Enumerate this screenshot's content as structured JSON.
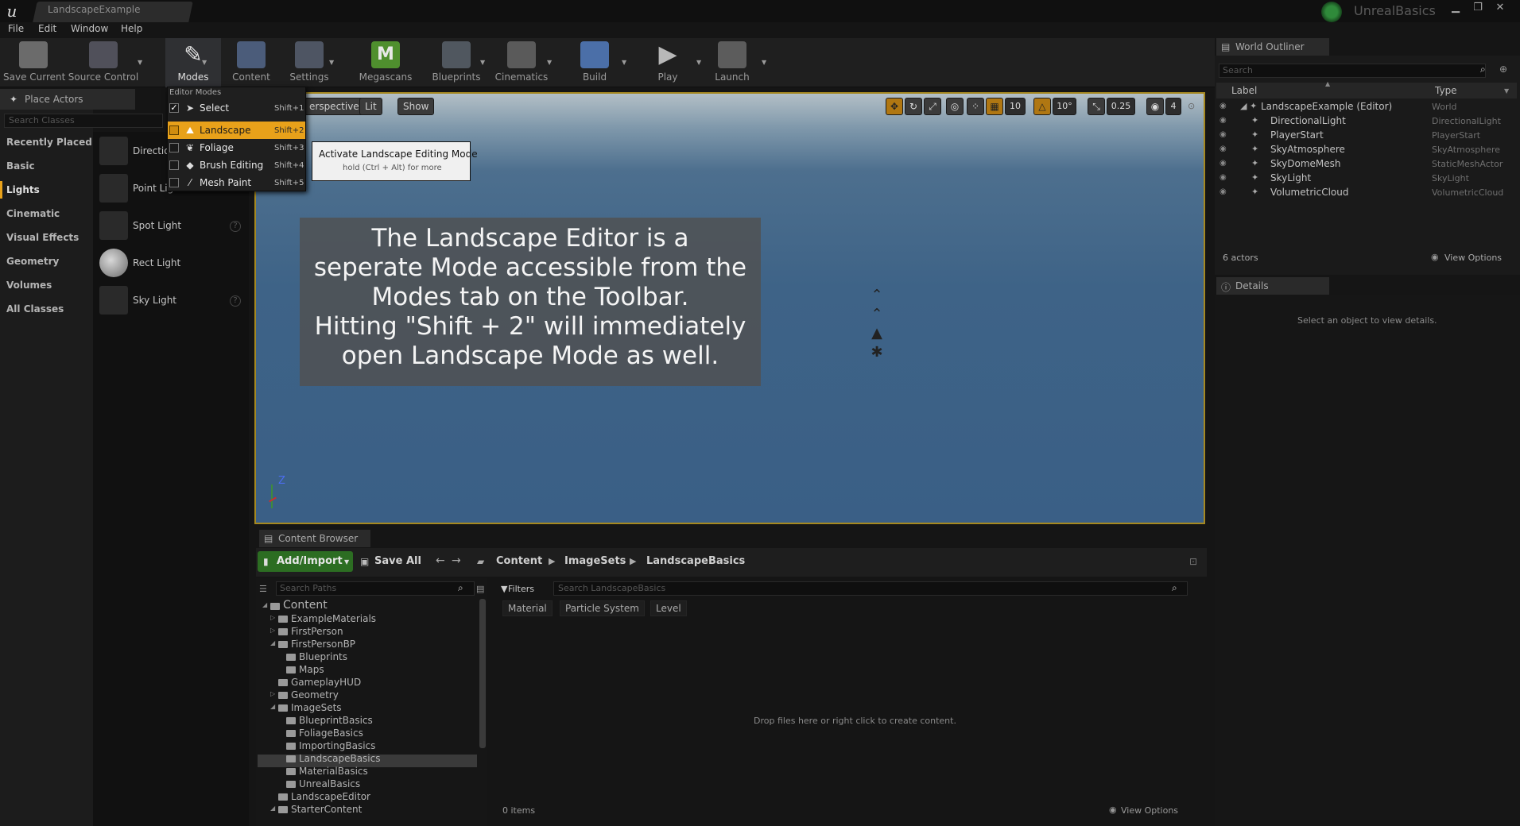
{
  "window": {
    "document_tab": "LandscapeExample",
    "project_name": "UnrealBasics",
    "minimize": "▁",
    "maximize": "❐",
    "close": "✕"
  },
  "menu": [
    "File",
    "Edit",
    "Window",
    "Help"
  ],
  "toolbar": {
    "save_current": "Save Current",
    "source_control": "Source Control",
    "modes": "Modes",
    "content": "Content",
    "settings": "Settings",
    "megascans": "Megascans",
    "blueprints": "Blueprints",
    "cinematics": "Cinematics",
    "build": "Build",
    "play": "Play",
    "launch": "Launch"
  },
  "place_actors": {
    "title": "Place Actors",
    "search_placeholder": "Search Classes",
    "categories": [
      "Recently Placed",
      "Basic",
      "Lights",
      "Cinematic",
      "Visual Effects",
      "Geometry",
      "Volumes",
      "All Classes"
    ],
    "selected_category": "Lights",
    "items": [
      "Directio",
      "Point Lig",
      "Spot Light",
      "Rect Light",
      "Sky Light"
    ]
  },
  "modes_menu": {
    "header": "Editor Modes",
    "items": [
      {
        "label": "Select",
        "shortcut": "Shift+1",
        "checked": "✓"
      },
      {
        "label": "Landscape",
        "shortcut": "Shift+2",
        "checked": ""
      },
      {
        "label": "Foliage",
        "shortcut": "Shift+3",
        "checked": ""
      },
      {
        "label": "Brush Editing",
        "shortcut": "Shift+4",
        "checked": ""
      },
      {
        "label": "Mesh Paint",
        "shortcut": "Shift+5",
        "checked": ""
      }
    ]
  },
  "tooltip": {
    "title": "Activate Landscape Editing Mode",
    "subtitle": "hold (Ctrl + Alt) for more"
  },
  "viewport": {
    "view_mode": "erspective",
    "lighting": "Lit",
    "show": "Show",
    "grid_snap": "10",
    "rotation_snap": "10°",
    "scale_snap": "0.25",
    "camera_speed": "4",
    "overlay_text": "The Landscape Editor is a\nseperate Mode accessible from the\nModes tab on the Toolbar.\nHitting \"Shift + 2\" will immediately\nopen Landscape Mode as well.",
    "axis_label": "Z"
  },
  "content_browser": {
    "title": "Content Browser",
    "add_import": "Add/Import",
    "save_all": "Save All",
    "breadcrumb": [
      "Content",
      "ImageSets",
      "LandscapeBasics"
    ],
    "paths_placeholder": "Search Paths",
    "filters_label": "Filters",
    "assets_placeholder": "Search LandscapeBasics",
    "filter_chips": [
      "Material",
      "Particle System",
      "Level"
    ],
    "tree": [
      {
        "label": "Content",
        "depth": 0,
        "arrow": "◢"
      },
      {
        "label": "ExampleMaterials",
        "depth": 1,
        "arrow": "▷"
      },
      {
        "label": "FirstPerson",
        "depth": 1,
        "arrow": "▷"
      },
      {
        "label": "FirstPersonBP",
        "depth": 1,
        "arrow": "◢"
      },
      {
        "label": "Blueprints",
        "depth": 2,
        "arrow": ""
      },
      {
        "label": "Maps",
        "depth": 2,
        "arrow": ""
      },
      {
        "label": "GameplayHUD",
        "depth": 1,
        "arrow": ""
      },
      {
        "label": "Geometry",
        "depth": 1,
        "arrow": "▷"
      },
      {
        "label": "ImageSets",
        "depth": 1,
        "arrow": "◢"
      },
      {
        "label": "BlueprintBasics",
        "depth": 2,
        "arrow": ""
      },
      {
        "label": "FoliageBasics",
        "depth": 2,
        "arrow": ""
      },
      {
        "label": "ImportingBasics",
        "depth": 2,
        "arrow": ""
      },
      {
        "label": "LandscapeBasics",
        "depth": 2,
        "arrow": ""
      },
      {
        "label": "MaterialBasics",
        "depth": 2,
        "arrow": ""
      },
      {
        "label": "UnrealBasics",
        "depth": 2,
        "arrow": ""
      },
      {
        "label": "LandscapeEditor",
        "depth": 1,
        "arrow": ""
      },
      {
        "label": "StarterContent",
        "depth": 1,
        "arrow": "◢"
      }
    ],
    "drop_hint": "Drop files here or right click to create content.",
    "items_count": "0 items",
    "view_options": "View Options"
  },
  "world_outliner": {
    "title": "World Outliner",
    "search_placeholder": "Search",
    "col_label": "Label",
    "col_type": "Type",
    "rows": [
      {
        "label": "LandscapeExample (Editor)",
        "type": "World",
        "depth": 0
      },
      {
        "label": "DirectionalLight",
        "type": "DirectionalLight",
        "depth": 1
      },
      {
        "label": "PlayerStart",
        "type": "PlayerStart",
        "depth": 1
      },
      {
        "label": "SkyAtmosphere",
        "type": "SkyAtmosphere",
        "depth": 1
      },
      {
        "label": "SkyDomeMesh",
        "type": "StaticMeshActor",
        "depth": 1
      },
      {
        "label": "SkyLight",
        "type": "SkyLight",
        "depth": 1
      },
      {
        "label": "VolumetricCloud",
        "type": "VolumetricCloud",
        "depth": 1
      }
    ],
    "count": "6 actors",
    "view_options": "View Options"
  },
  "details": {
    "title": "Details",
    "hint": "Select an object to view details."
  },
  "colors": {
    "accent": "#e8a11a",
    "add_import_green": "#2c6d22",
    "viewport_border": "#a58820"
  }
}
